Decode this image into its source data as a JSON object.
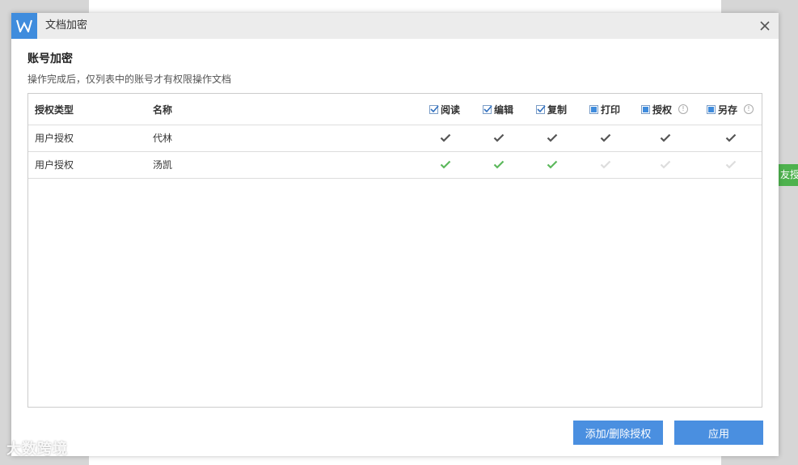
{
  "dialog": {
    "title": "文档加密",
    "section_title": "账号加密",
    "description": "操作完成后，仅列表中的账号才有权限操作文档"
  },
  "table": {
    "headers": {
      "type": "授权类型",
      "name": "名称"
    },
    "permissions": [
      {
        "label": "阅读",
        "state": "checked",
        "info": false
      },
      {
        "label": "编辑",
        "state": "checked",
        "info": false
      },
      {
        "label": "复制",
        "state": "checked",
        "info": false
      },
      {
        "label": "打印",
        "state": "partial",
        "info": false
      },
      {
        "label": "授权",
        "state": "partial",
        "info": true
      },
      {
        "label": "另存",
        "state": "partial",
        "info": true
      }
    ],
    "rows": [
      {
        "type": "用户授权",
        "name": "代林",
        "perms": [
          "dark",
          "dark",
          "dark",
          "dark",
          "dark",
          "dark"
        ]
      },
      {
        "type": "用户授权",
        "name": "汤凯",
        "perms": [
          "green",
          "green",
          "green",
          "light",
          "light",
          "light"
        ]
      }
    ]
  },
  "buttons": {
    "manage": "添加/删除授权",
    "apply": "应用"
  },
  "side_tab": "友授",
  "watermark": "大数跨境",
  "colors": {
    "accent": "#3f8cdd",
    "check_dark": "#555555",
    "check_green": "#5cb85c",
    "check_light": "#dddddd",
    "side_tab": "#4eb24e"
  }
}
